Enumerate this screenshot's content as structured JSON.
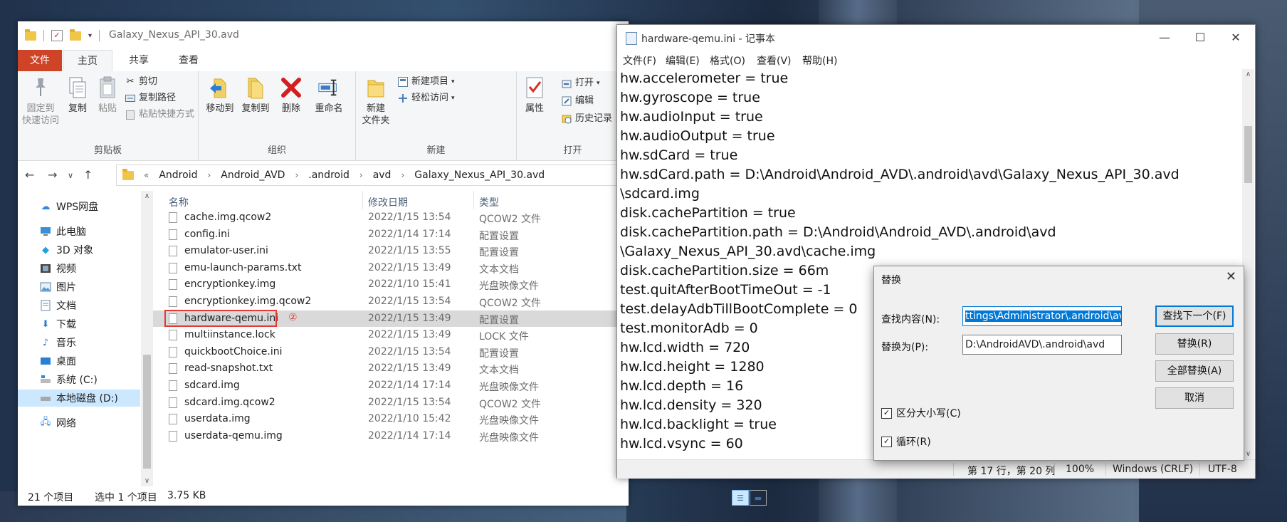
{
  "explorer": {
    "title": "Galaxy_Nexus_API_30.avd",
    "tabs": [
      "文件",
      "主页",
      "共享",
      "查看"
    ],
    "ribbon": {
      "clipboard": {
        "label": "剪贴板",
        "pin": "固定到\n快速访问",
        "copy": "复制",
        "paste": "粘贴",
        "cut": "剪切",
        "copy_path": "复制路径",
        "paste_shortcut": "粘贴快捷方式"
      },
      "organize": {
        "label": "组织",
        "move_to": "移动到",
        "copy_to": "复制到",
        "delete": "删除",
        "rename": "重命名"
      },
      "new": {
        "label": "新建",
        "new_folder": "新建\n文件夹",
        "new_item": "新建项目",
        "easy_access": "轻松访问"
      },
      "open": {
        "label": "打开",
        "properties": "属性",
        "open": "打开",
        "edit": "编辑",
        "history": "历史记录"
      }
    },
    "address": {
      "prefix": "«",
      "parts": [
        "Android",
        "Android_AVD",
        ".android",
        "avd",
        "Galaxy_Nexus_API_30.avd"
      ]
    },
    "nav": {
      "wps": "WPS网盘",
      "this_pc": "此电脑",
      "objects3d": "3D 对象",
      "videos": "视频",
      "pictures": "图片",
      "documents": "文档",
      "downloads": "下载",
      "music": "音乐",
      "desktop": "桌面",
      "system_c": "系统 (C:)",
      "local_d": "本地磁盘 (D:)",
      "network": "网络"
    },
    "columns": {
      "name": "名称",
      "date": "修改日期",
      "type": "类型"
    },
    "files": [
      {
        "name": "cache.img.qcow2",
        "date": "2022/1/15 13:54",
        "type": "QCOW2 文件"
      },
      {
        "name": "config.ini",
        "date": "2022/1/14 17:14",
        "type": "配置设置"
      },
      {
        "name": "emulator-user.ini",
        "date": "2022/1/15 13:55",
        "type": "配置设置"
      },
      {
        "name": "emu-launch-params.txt",
        "date": "2022/1/15 13:49",
        "type": "文本文档"
      },
      {
        "name": "encryptionkey.img",
        "date": "2022/1/10 15:41",
        "type": "光盘映像文件"
      },
      {
        "name": "encryptionkey.img.qcow2",
        "date": "2022/1/15 13:54",
        "type": "QCOW2 文件"
      },
      {
        "name": "hardware-qemu.ini",
        "date": "2022/1/15 13:49",
        "type": "配置设置"
      },
      {
        "name": "multiinstance.lock",
        "date": "2022/1/15 13:49",
        "type": "LOCK 文件"
      },
      {
        "name": "quickbootChoice.ini",
        "date": "2022/1/15 13:54",
        "type": "配置设置"
      },
      {
        "name": "read-snapshot.txt",
        "date": "2022/1/15 13:49",
        "type": "文本文档"
      },
      {
        "name": "sdcard.img",
        "date": "2022/1/14 17:14",
        "type": "光盘映像文件"
      },
      {
        "name": "sdcard.img.qcow2",
        "date": "2022/1/15 13:54",
        "type": "QCOW2 文件"
      },
      {
        "name": "userdata.img",
        "date": "2022/1/10 15:42",
        "type": "光盘映像文件"
      },
      {
        "name": "userdata-qemu.img",
        "date": "2022/1/14 17:14",
        "type": "光盘映像文件"
      }
    ],
    "highlight_marker": "②",
    "status": {
      "count": "21 个项目",
      "selected": "选中 1 个项目",
      "size": "3.75 KB"
    }
  },
  "notepad": {
    "title": "hardware-qemu.ini - 记事本",
    "menu": [
      "文件(F)",
      "编辑(E)",
      "格式(O)",
      "查看(V)",
      "帮助(H)"
    ],
    "lines": [
      "hw.accelerometer = true",
      "hw.gyroscope = true",
      "hw.audioInput = true",
      "hw.audioOutput = true",
      "hw.sdCard = true",
      "hw.sdCard.path = D:\\Android\\Android_AVD\\.android\\avd\\Galaxy_Nexus_API_30.avd",
      "\\sdcard.img",
      "disk.cachePartition = true",
      "disk.cachePartition.path = D:\\Android\\Android_AVD\\.android\\avd",
      "\\Galaxy_Nexus_API_30.avd\\cache.img",
      "disk.cachePartition.size = 66m",
      "test.quitAfterBootTimeOut = -1",
      "test.delayAdbTillBootComplete = 0",
      "test.monitorAdb = 0",
      "hw.lcd.width = 720",
      "hw.lcd.height = 1280",
      "hw.lcd.depth = 16",
      "hw.lcd.density = 320",
      "hw.lcd.backlight = true",
      "hw.lcd.vsync = 60"
    ],
    "status": {
      "position": "第 17 行，第 20 列",
      "zoom": "100%",
      "eol": "Windows (CRLF)",
      "encoding": "UTF-8"
    }
  },
  "replace_dialog": {
    "title": "替换",
    "find_label": "查找内容(N):",
    "find_value": "ttings\\Administrator\\.android\\avd",
    "replace_label": "替换为(P):",
    "replace_value": "D:\\AndroidAVD\\.android\\avd",
    "find_next": "查找下一个(F)",
    "replace": "替换(R)",
    "replace_all": "全部替换(A)",
    "cancel": "取消",
    "match_case": "区分大小写(C)",
    "wrap": "循环(R)"
  },
  "colors": {
    "file_tab": "#cf4326",
    "accent": "#0078d7",
    "highlight": "#e53935"
  }
}
